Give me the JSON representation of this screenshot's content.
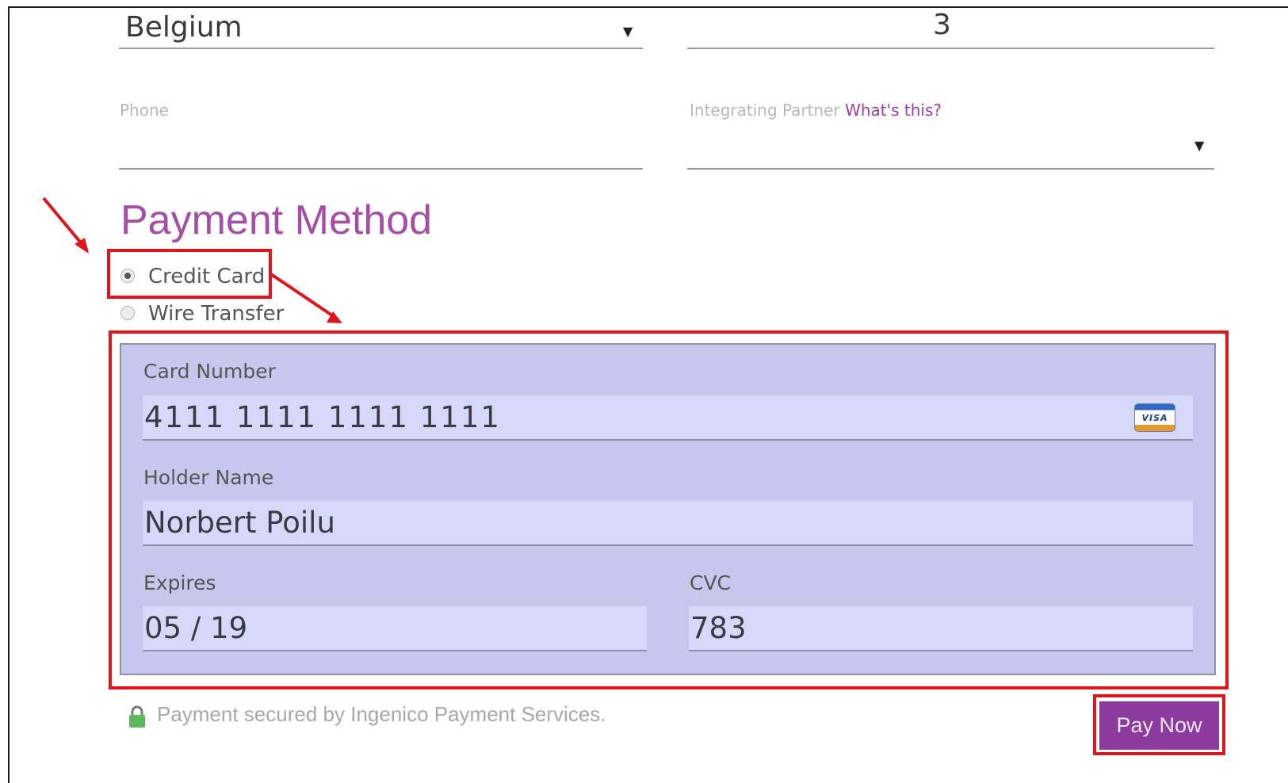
{
  "address": {
    "country_value": "Belgium",
    "right_value": "3"
  },
  "phone": {
    "label": "Phone",
    "value": ""
  },
  "partner": {
    "label": "Integrating Partner",
    "help_link": "What's this?",
    "value": ""
  },
  "payment": {
    "heading": "Payment Method",
    "options": [
      {
        "label": "Credit Card",
        "selected": true
      },
      {
        "label": "Wire Transfer",
        "selected": false
      }
    ]
  },
  "card": {
    "number_label": "Card Number",
    "number_value": "4111 1111 1111 1111",
    "brand_icon": "visa-card-icon",
    "brand_text": "VISA",
    "holder_label": "Holder Name",
    "holder_value": "Norbert Poilu",
    "expires_label": "Expires",
    "expires_value": "05 / 19",
    "cvc_label": "CVC",
    "cvc_value": "783"
  },
  "footer": {
    "secured_text": "Payment secured by Ingenico Payment Services.",
    "lock_icon": "lock-icon",
    "pay_button": "Pay Now"
  },
  "colors": {
    "accent": "#8b3a9e",
    "heading": "#a64ea6",
    "annotation": "#e0141b",
    "panel": "#c5c7ec"
  }
}
